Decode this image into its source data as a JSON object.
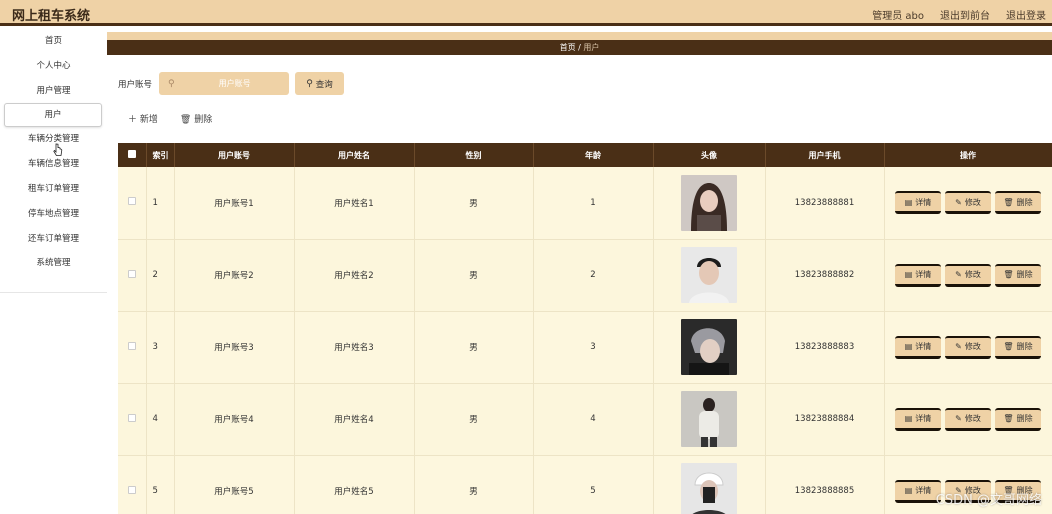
{
  "app": {
    "title": "网上租车系统"
  },
  "topbar": {
    "user_label": "管理员 abo",
    "to_front": "退出到前台",
    "logout": "退出登录"
  },
  "sidebar": {
    "items": [
      {
        "label": "首页"
      },
      {
        "label": "个人中心"
      },
      {
        "label": "用户管理"
      },
      {
        "label": "用户"
      },
      {
        "label": "车辆分类管理"
      },
      {
        "label": "车辆信息管理"
      },
      {
        "label": "租车订单管理"
      },
      {
        "label": "停车地点管理"
      },
      {
        "label": "还车订单管理"
      },
      {
        "label": "系统管理"
      }
    ]
  },
  "breadcrumb": {
    "home": "首页",
    "sep": "/",
    "current": "用户"
  },
  "search": {
    "label": "用户账号",
    "placeholder": "用户账号",
    "button": "查询",
    "search_icon": "search-icon"
  },
  "actions": {
    "add": "新增",
    "delete": "删除"
  },
  "table": {
    "headers": [
      "索引",
      "用户账号",
      "用户姓名",
      "性别",
      "年龄",
      "头像",
      "用户手机",
      "操作"
    ],
    "ops": {
      "detail": "详情",
      "edit": "修改",
      "delete": "删除"
    },
    "rows": [
      {
        "index": "1",
        "account": "用户账号1",
        "name": "用户姓名1",
        "gender": "男",
        "age": "1",
        "phone": "13823888881"
      },
      {
        "index": "2",
        "account": "用户账号2",
        "name": "用户姓名2",
        "gender": "男",
        "age": "2",
        "phone": "13823888882"
      },
      {
        "index": "3",
        "account": "用户账号3",
        "name": "用户姓名3",
        "gender": "男",
        "age": "3",
        "phone": "13823888883"
      },
      {
        "index": "4",
        "account": "用户账号4",
        "name": "用户姓名4",
        "gender": "男",
        "age": "4",
        "phone": "13823888884"
      },
      {
        "index": "5",
        "account": "用户账号5",
        "name": "用户姓名5",
        "gender": "男",
        "age": "5",
        "phone": "13823888885"
      }
    ]
  },
  "watermark": "CSDN @文哥网络",
  "colors": {
    "accent": "#efd2a6",
    "dark": "#4a2f16",
    "row_bg": "#fdf7de"
  }
}
